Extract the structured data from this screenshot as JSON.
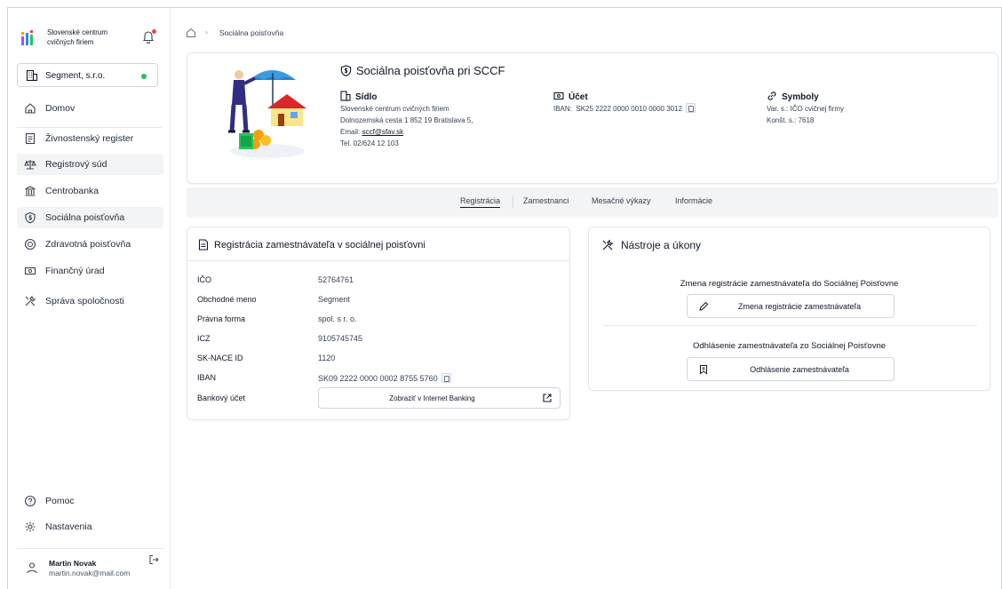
{
  "app": {
    "brand_name_line1": "Slovenské centrum",
    "brand_name_line2": "cvičných firiem",
    "company": "Segment, s.r.o."
  },
  "sidebar": {
    "items": [
      {
        "label": "Domov",
        "icon": "home-icon"
      },
      {
        "label": "Živnostenský register",
        "icon": "register-icon"
      },
      {
        "label": "Registrový súd",
        "icon": "scales-icon"
      },
      {
        "label": "Centrobanka",
        "icon": "bank-icon"
      },
      {
        "label": "Sociálna poisťovňa",
        "icon": "shield-dollar-icon"
      },
      {
        "label": "Zdravotná poisťovňa",
        "icon": "health-icon"
      },
      {
        "label": "Finančný úrad",
        "icon": "finance-icon"
      },
      {
        "label": "Správa spoločnosti",
        "icon": "tools-icon"
      }
    ],
    "help": "Pomoc",
    "settings": "Nastavenia",
    "user_name": "Martin Novak",
    "user_email": "martin.novak@mail.com"
  },
  "breadcrumb": {
    "current": "Sociálna poisťovňa"
  },
  "hero": {
    "title": "Sociálna poisťovňa pri SCCF",
    "sidlo": {
      "heading": "Sídlo",
      "line1": "Slovenské centrum cvičných firiem",
      "line2": "Dolnozemská cesta 1 852 19 Bratislava 5,",
      "email_label": "Email:",
      "email": "sccf@sfav.sk",
      "phone": "Tel. 02/624 12 103"
    },
    "ucet": {
      "heading": "Účet",
      "iban_label": "IBAN:",
      "iban": "SK25 2222 0000 0010 0000 3012"
    },
    "symboly": {
      "heading": "Symboly",
      "line1": "Var. s.: IČO cvičnej firmy",
      "line2": "Konšt. s.: 7618"
    }
  },
  "tabs": [
    "Registrácia",
    "Zamestnanci",
    "Mesačné výkazy",
    "Informácie"
  ],
  "registration": {
    "title": "Registrácia zamestnávateľa v sociálnej poisťovni",
    "rows": [
      {
        "key": "IČO",
        "value": "52764761"
      },
      {
        "key": "Obchodné meno",
        "value": "Segment"
      },
      {
        "key": "Právna forma",
        "value": "spol. s r. o."
      },
      {
        "key": "ICZ",
        "value": "9105745745"
      },
      {
        "key": "SK-NACE ID",
        "value": "1120"
      },
      {
        "key": "IBAN",
        "value": "SK09 2222 0000 0002 8755 5760"
      }
    ],
    "bank_account_label": "Bankový účet",
    "bank_button": "Zobraziť v Internet Banking"
  },
  "tools": {
    "title": "Nástroje a úkony",
    "section1_heading": "Zmena registrácie zamestnávateľa do Sociálnej Poisťovne",
    "section1_button": "Zmena registrácie zamestnávateľa",
    "section2_heading": "Odhlásenie zamestnávateľa zo Sociálnej Poisťovne",
    "section2_button": "Odhlásenie zamestnávateľa"
  },
  "colors": {
    "accent": "#1f2937",
    "status_online": "#22c55e",
    "notification": "#ef4444"
  }
}
